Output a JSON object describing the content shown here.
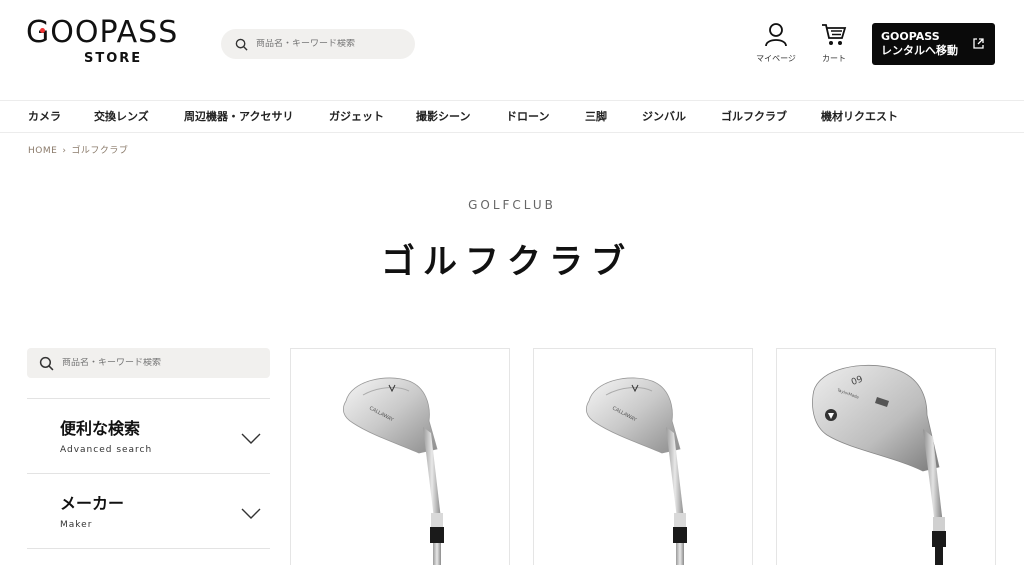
{
  "header": {
    "logo_main": "GOOPASS",
    "logo_sub": "STORE",
    "search_placeholder": "商品名・キーワード検索",
    "mypage_label": "マイページ",
    "cart_label": "カート",
    "rental_line1": "GOOPASS",
    "rental_line2": "レンタルへ移動",
    "icons": [
      "search-icon",
      "user-icon",
      "cart-icon",
      "external-link-icon"
    ]
  },
  "nav": {
    "items": [
      "カメラ",
      "交換レンズ",
      "周辺機器・アクセサリ",
      "ガジェット",
      "撮影シーン",
      "ドローン",
      "三脚",
      "ジンバル",
      "ゴルフクラブ",
      "機材リクエスト"
    ]
  },
  "breadcrumb": {
    "home": "HOME",
    "current": "ゴルフクラブ"
  },
  "page": {
    "title_en": "GOLFCLUB",
    "title_jp": "ゴルフクラブ"
  },
  "sidebar": {
    "search_placeholder": "商品名・キーワード検索",
    "filters": [
      {
        "title": "便利な検索",
        "subtitle": "Advanced search"
      },
      {
        "title": "メーカー",
        "subtitle": "Maker"
      }
    ]
  },
  "products": {
    "items": [
      {
        "head_mark": "CALLAWAY",
        "finish": "silver"
      },
      {
        "head_mark": "CALLAWAY",
        "finish": "silver"
      },
      {
        "head_mark": "TaylorMade",
        "loft": "60",
        "finish": "silver"
      }
    ]
  },
  "colors": {
    "accent_dark": "#0a0a0a",
    "search_bg": "#f1f0ee",
    "breadcrumb": "#8a7a6a",
    "logo_dot": "#ee3333"
  }
}
